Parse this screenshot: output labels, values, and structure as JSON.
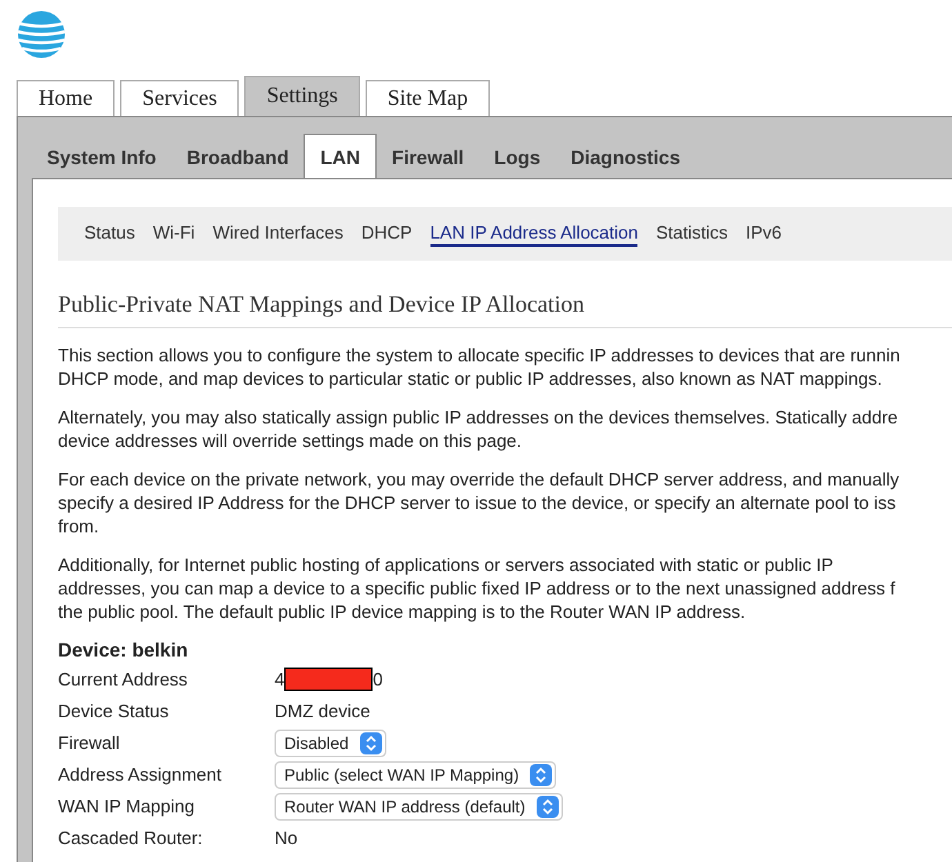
{
  "main_tabs": [
    {
      "label": "Home",
      "selected": false
    },
    {
      "label": "Services",
      "selected": false
    },
    {
      "label": "Settings",
      "selected": true
    },
    {
      "label": "Site Map",
      "selected": false
    }
  ],
  "sub_tabs": [
    {
      "label": "System Info",
      "selected": false
    },
    {
      "label": "Broadband",
      "selected": false
    },
    {
      "label": "LAN",
      "selected": true
    },
    {
      "label": "Firewall",
      "selected": false
    },
    {
      "label": "Logs",
      "selected": false
    },
    {
      "label": "Diagnostics",
      "selected": false
    }
  ],
  "section_nav": [
    {
      "label": "Status",
      "selected": false
    },
    {
      "label": "Wi-Fi",
      "selected": false
    },
    {
      "label": "Wired Interfaces",
      "selected": false
    },
    {
      "label": "DHCP",
      "selected": false
    },
    {
      "label": "LAN IP Address Allocation",
      "selected": true
    },
    {
      "label": "Statistics",
      "selected": false
    },
    {
      "label": "IPv6",
      "selected": false
    }
  ],
  "heading": "Public-Private NAT Mappings and Device IP Allocation",
  "paragraphs": [
    [
      "This section allows you to configure the system to allocate specific IP addresses to devices that are runnin",
      "DHCP mode, and map devices to particular static or public IP addresses, also known as NAT mappings."
    ],
    [
      "Alternately, you may also statically assign public IP addresses on the devices themselves. Statically addre",
      "device addresses will override settings made on this page."
    ],
    [
      "For each device on the private network, you may override the default DHCP server address, and manually",
      "specify a desired IP Address for the DHCP server to issue to the device, or specify an alternate pool to iss",
      "from."
    ],
    [
      "Additionally, for Internet public hosting of applications or servers associated with static or public IP",
      "addresses, you can map a device to a specific public fixed IP address or to the next unassigned address f",
      "the public pool. The default public IP device mapping is to the Router WAN IP address."
    ]
  ],
  "device_title": "Device: belkin",
  "fields": [
    {
      "kind": "redacted",
      "label": "Current Address",
      "value_start": "4",
      "value_end": "0"
    },
    {
      "kind": "text",
      "label": "Device Status",
      "value": "DMZ device"
    },
    {
      "kind": "select",
      "label": "Firewall",
      "value": "Disabled"
    },
    {
      "kind": "select",
      "label": "Address Assignment",
      "value": "Public (select WAN IP Mapping)"
    },
    {
      "kind": "select",
      "label": "WAN IP Mapping",
      "value": "Router WAN IP address (default)"
    },
    {
      "kind": "text",
      "label": "Cascaded Router:",
      "value": "No"
    }
  ]
}
